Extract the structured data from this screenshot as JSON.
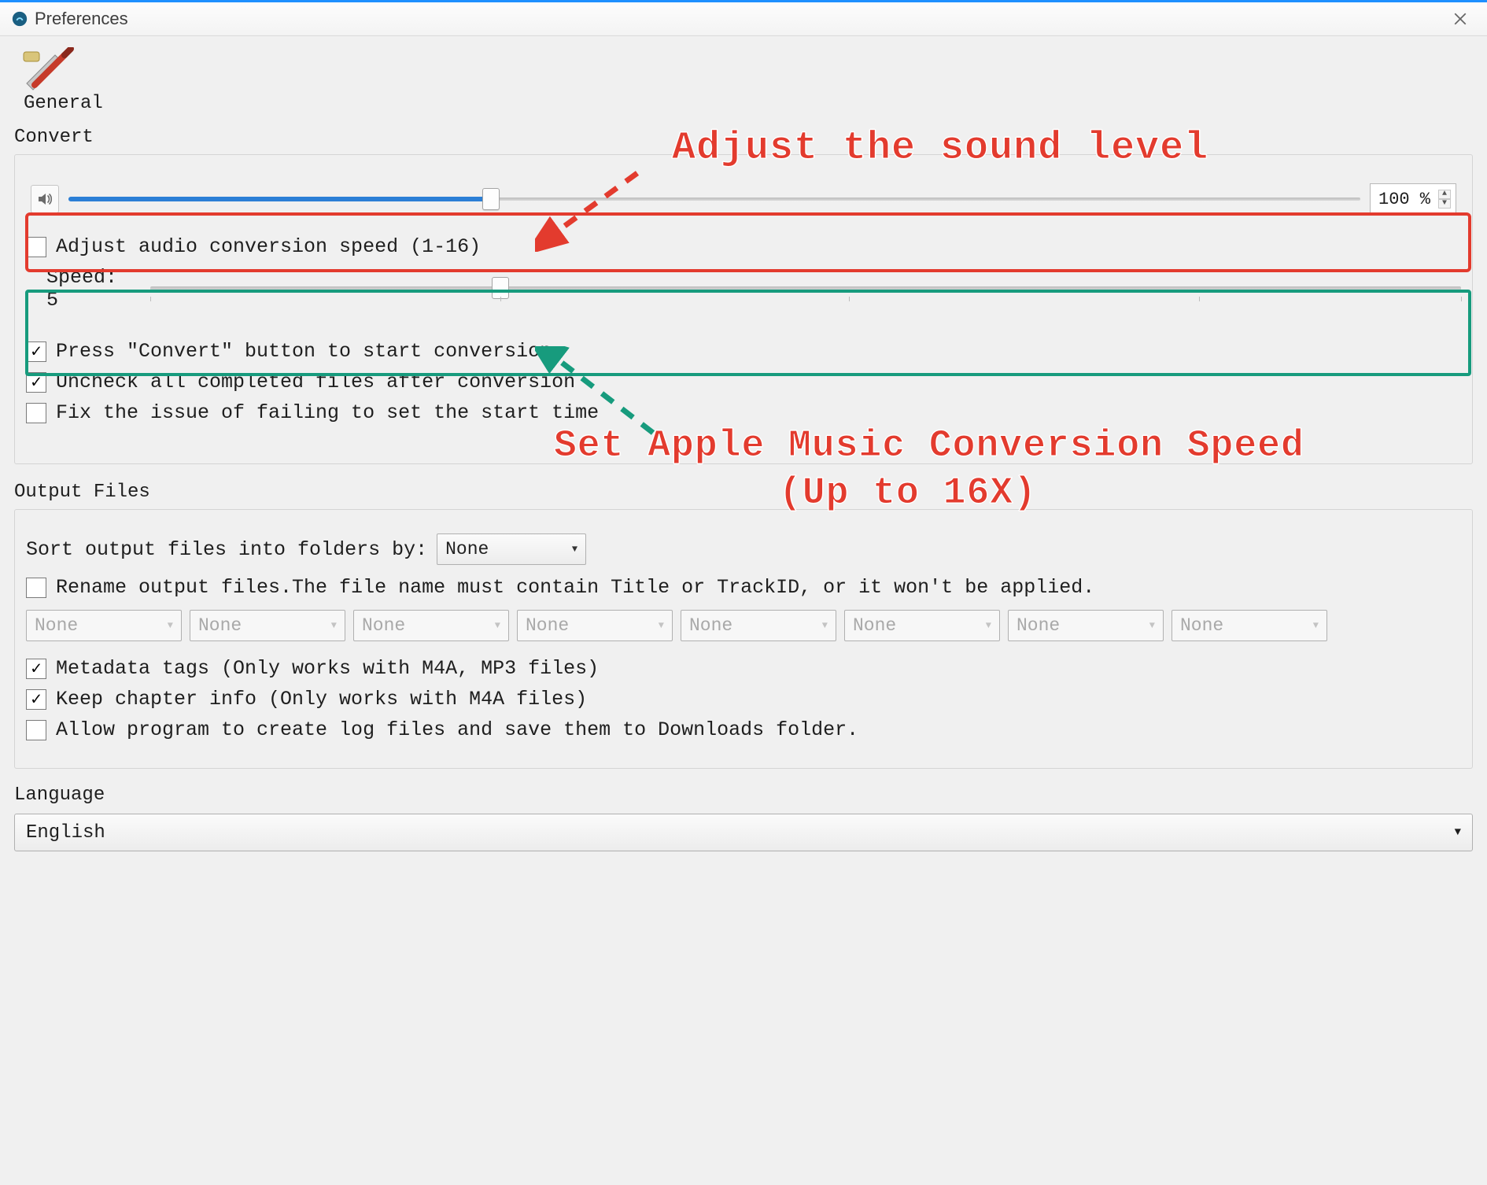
{
  "window": {
    "title": "Preferences"
  },
  "tabs": {
    "general": "General"
  },
  "sections": {
    "convert": "Convert",
    "output_files": "Output Files",
    "language": "Language"
  },
  "convert": {
    "volume_percent": "100 %",
    "volume_fill_percent": 32.7,
    "adjust_speed_label": "Adjust audio conversion speed (1-16)",
    "adjust_speed_checked": false,
    "speed_label": "Speed: 5",
    "speed_thumb_percent": 26.7,
    "press_convert_label": "Press \"Convert\" button to start conversion",
    "press_convert_checked": true,
    "uncheck_completed_label": "Uncheck all completed files after conversion",
    "uncheck_completed_checked": true,
    "fix_start_time_label": "Fix the issue of failing to set the start time",
    "fix_start_time_checked": false
  },
  "output": {
    "sort_by_label": "Sort output files into folders by:",
    "sort_by_value": "None",
    "rename_label": "Rename output files.The file name must contain Title or TrackID, or it won't be applied.",
    "rename_checked": false,
    "rename_slots": [
      "None",
      "None",
      "None",
      "None",
      "None",
      "None",
      "None",
      "None"
    ],
    "metadata_label": "Metadata tags (Only works with M4A, MP3 files)",
    "metadata_checked": true,
    "chapter_label": "Keep chapter info (Only works with M4A files)",
    "chapter_checked": true,
    "log_label": "Allow program to create log files and save them to Downloads folder.",
    "log_checked": false
  },
  "language": {
    "value": "English"
  },
  "annotations": {
    "sound_level": "Adjust the sound level",
    "speed_line1": "Set Apple Music Conversion Speed",
    "speed_line2": "(Up to 16X)",
    "anno_color_red": "#e33b2e",
    "anno_color_teal": "#179b7d"
  }
}
